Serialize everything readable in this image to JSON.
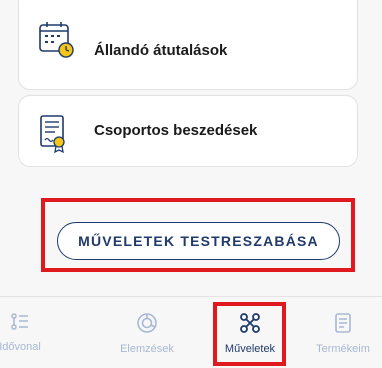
{
  "cards": [
    {
      "label": "Állandó átutalások",
      "icon": "calendar-clock-icon"
    },
    {
      "label": "Csoportos beszedések",
      "icon": "document-badge-icon"
    }
  ],
  "customize_button": {
    "label": "MŰVELETEK TESTRESZABÁSA"
  },
  "nav": [
    {
      "label": "Idővonal",
      "icon": "timeline-icon"
    },
    {
      "label": "Elemzések",
      "icon": "analytics-icon"
    },
    {
      "label": "Műveletek",
      "icon": "operations-icon",
      "active": true
    },
    {
      "label": "Termékeim",
      "icon": "products-icon"
    }
  ],
  "colors": {
    "accent": "#1f3a6b",
    "inactive": "#a8b8d3",
    "highlight": "#e0191f"
  }
}
